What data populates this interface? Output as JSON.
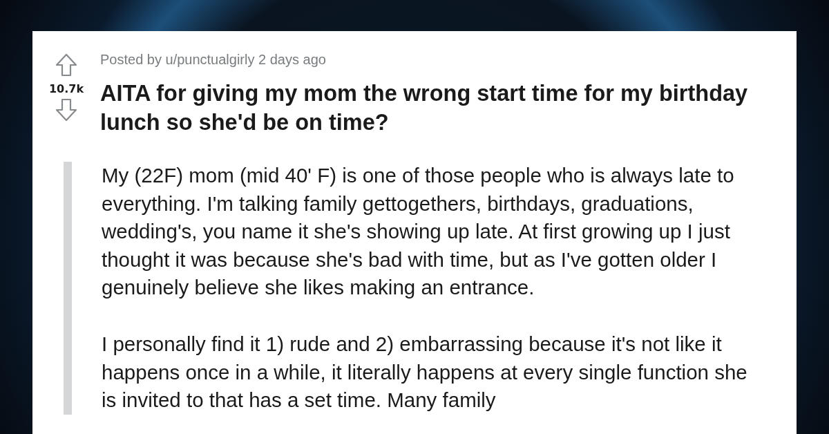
{
  "post": {
    "meta": "Posted by u/punctualgirly 2 days ago",
    "score": "10.7k",
    "title": "AITA for giving my mom the wrong start time for my birthday lunch so she'd be on time?",
    "body": [
      "My (22F) mom (mid 40' F) is one of those people who is always late to everything. I'm talking family gettogethers, birthdays, graduations, wedding's, you name it she's showing up late. At first growing up I just thought it was because she's bad with time, but as I've gotten older I genuinely believe she likes making an entrance.",
      "I personally find it 1) rude and 2) embarrassing because it's not like it happens once in a while, it literally happens at every single function she is invited to that has a set time. Many family"
    ]
  }
}
